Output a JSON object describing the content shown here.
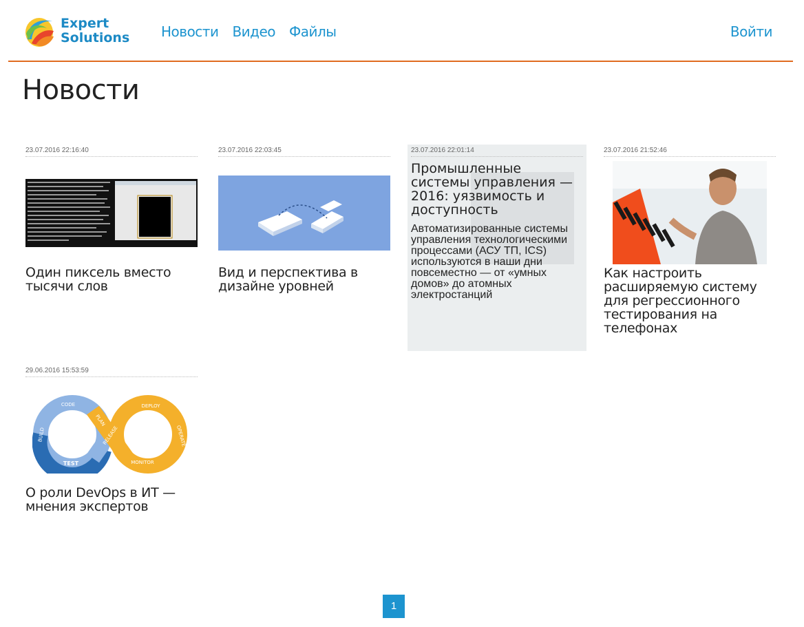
{
  "brand": {
    "line1": "Expert",
    "line2": "Solutions"
  },
  "nav": {
    "items": [
      "Новости",
      "Видео",
      "Файлы"
    ],
    "login": "Войти"
  },
  "page_title": "Новости",
  "articles": [
    {
      "date": "23.07.2016 22:16:40",
      "title": "Один пиксель вместо тысячи слов"
    },
    {
      "date": "23.07.2016 22:03:45",
      "title": "Вид и перспектива в дизайне уровней"
    },
    {
      "date": "23.07.2016 22:01:14",
      "title": "Промышленные системы управления — 2016: уязвимость и доступность",
      "description": "Автоматизированные системы управления технологическими процессами (АСУ ТП, ICS) используются в наши дни повсеместно — от «умных домов» до атомных электростанций"
    },
    {
      "date": "23.07.2016 21:52:46",
      "title": "Как настроить расширяемую систему для регрессионного тестирования на телефонах"
    },
    {
      "date": "29.06.2016 15:53:59",
      "title": "О роли DevOps в ИТ — мнения экспертов"
    }
  ],
  "devops_labels": [
    "CODE",
    "PLAN",
    "BUILD",
    "TEST",
    "RELEASE",
    "DEPLOY",
    "OPERATE",
    "MONITOR"
  ],
  "pagination": {
    "current": "1"
  },
  "colors": {
    "accent": "#1d94cf",
    "divider": "#e06b1f"
  }
}
